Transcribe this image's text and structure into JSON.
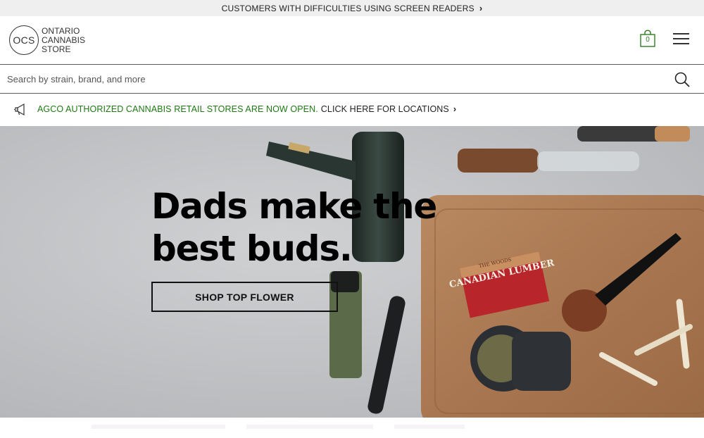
{
  "topbar": {
    "text": "CUSTOMERS WITH DIFFICULTIES USING SCREEN READERS",
    "chevron": "›"
  },
  "header": {
    "logo": {
      "mark": "OCS",
      "line1": "ONTARIO",
      "line2": "CANNABIS",
      "line3": "STORE"
    },
    "cart": {
      "count": "0",
      "icon": "shopping-bag-icon"
    },
    "menu": {
      "icon": "hamburger-menu-icon"
    }
  },
  "search": {
    "placeholder": "Search by strain, brand, and more",
    "value": "",
    "icon": "search-icon"
  },
  "announcement": {
    "icon": "megaphone-icon",
    "highlight": "AGCO AUTHORIZED CANNABIS RETAIL STORES ARE NOW OPEN.",
    "link": "CLICK HERE FOR LOCATIONS",
    "chevron": "›"
  },
  "hero": {
    "title": "Dads make the best buds.",
    "cta": "SHOP TOP FLOWER",
    "product_box_label": "CANADIAN LUMBER",
    "product_box_sublabel": "THE WOODS"
  },
  "colors": {
    "accent_green": "#1e7a12",
    "cart_green": "#2e7d1e",
    "topbar_bg": "#efefef"
  }
}
